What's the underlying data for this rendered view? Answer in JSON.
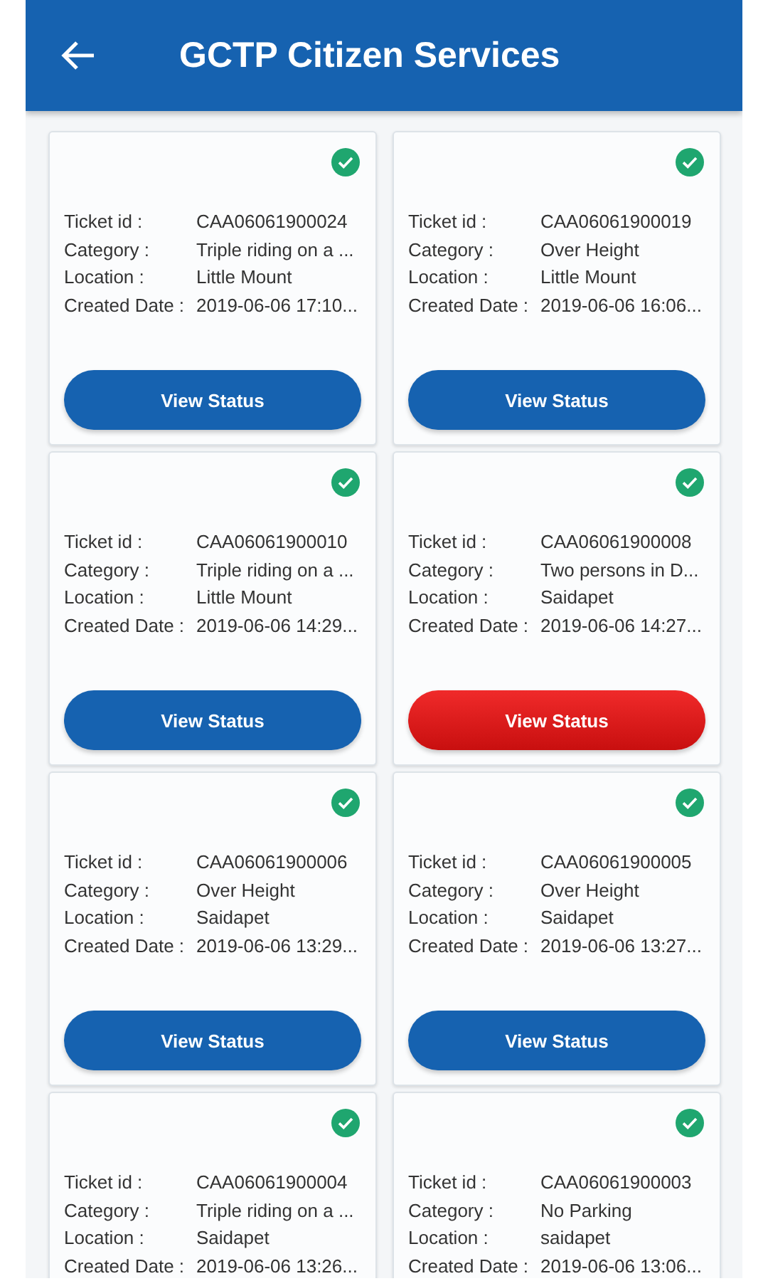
{
  "header": {
    "title": "GCTP Citizen Services"
  },
  "tickets": [
    {
      "done": true,
      "fields": [
        {
          "label": "Ticket id :",
          "value": "CAA06061900024"
        },
        {
          "label": "Category :",
          "value": "Triple riding on a ..."
        },
        {
          "label": "Location :",
          "value": "Little Mount"
        },
        {
          "label": "Created Date :",
          "value": "2019-06-06 17:10..."
        }
      ],
      "button": {
        "label": "View Status",
        "pressed": false
      }
    },
    {
      "done": true,
      "fields": [
        {
          "label": "Ticket id :",
          "value": "CAA06061900019"
        },
        {
          "label": "Category :",
          "value": "Over Height"
        },
        {
          "label": "Location :",
          "value": "Little Mount"
        },
        {
          "label": "Created Date :",
          "value": "2019-06-06 16:06..."
        }
      ],
      "button": {
        "label": "View Status",
        "pressed": false
      }
    },
    {
      "done": true,
      "fields": [
        {
          "label": "Ticket id :",
          "value": "CAA06061900010"
        },
        {
          "label": "Category :",
          "value": "Triple riding on a ..."
        },
        {
          "label": "Location :",
          "value": "Little Mount"
        },
        {
          "label": "Created Date :",
          "value": "2019-06-06 14:29..."
        }
      ],
      "button": {
        "label": "View Status",
        "pressed": false
      }
    },
    {
      "done": true,
      "fields": [
        {
          "label": "Ticket id :",
          "value": "CAA06061900008"
        },
        {
          "label": "Category :",
          "value": "Two persons in D..."
        },
        {
          "label": "Location :",
          "value": "Saidapet"
        },
        {
          "label": "Created Date :",
          "value": "2019-06-06 14:27..."
        }
      ],
      "button": {
        "label": "View Status",
        "pressed": true
      }
    },
    {
      "done": true,
      "fields": [
        {
          "label": "Ticket id :",
          "value": "CAA06061900006"
        },
        {
          "label": "Category :",
          "value": "Over Height"
        },
        {
          "label": "Location :",
          "value": "Saidapet"
        },
        {
          "label": "Created Date :",
          "value": "2019-06-06 13:29..."
        }
      ],
      "button": {
        "label": "View Status",
        "pressed": false
      }
    },
    {
      "done": true,
      "fields": [
        {
          "label": "Ticket id :",
          "value": "CAA06061900005"
        },
        {
          "label": "Category :",
          "value": "Over Height"
        },
        {
          "label": "Location :",
          "value": "Saidapet"
        },
        {
          "label": "Created Date :",
          "value": "2019-06-06 13:27..."
        }
      ],
      "button": {
        "label": "View Status",
        "pressed": false
      }
    },
    {
      "done": true,
      "fields": [
        {
          "label": "Ticket id :",
          "value": "CAA06061900004"
        },
        {
          "label": "Category :",
          "value": "Triple riding on a ..."
        },
        {
          "label": "Location :",
          "value": "Saidapet"
        },
        {
          "label": "Created Date :",
          "value": "2019-06-06 13:26..."
        }
      ]
    },
    {
      "done": true,
      "fields": [
        {
          "label": "Ticket id :",
          "value": "CAA06061900003"
        },
        {
          "label": "Category :",
          "value": "No Parking"
        },
        {
          "label": "Location :",
          "value": "saidapet"
        },
        {
          "label": "Created Date :",
          "value": "2019-06-06 13:06..."
        }
      ]
    }
  ]
}
